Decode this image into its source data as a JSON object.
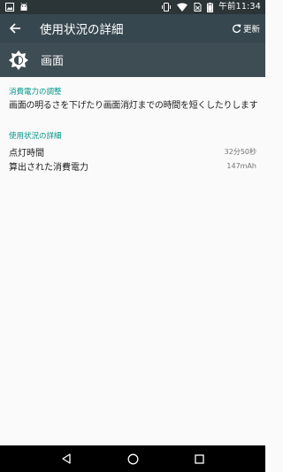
{
  "status_bar": {
    "time": "午前11:34",
    "left_icons": [
      "image-icon",
      "android-icon"
    ],
    "right_icons": [
      "vibrate-icon",
      "wifi-icon",
      "no-sim-icon",
      "battery-icon"
    ]
  },
  "app_bar": {
    "title": "使用状況の詳細",
    "refresh_label": "更新"
  },
  "header": {
    "title": "画面",
    "icon": "brightness-icon"
  },
  "suggestion": {
    "heading": "消費電力の調整",
    "text": "画面の明るさを下げたり画面消灯までの時間を短くしたりします"
  },
  "usage": {
    "heading": "使用状況の詳細",
    "rows": [
      {
        "label": "点灯時間",
        "value": "32分50秒"
      },
      {
        "label": "算出された消費電力",
        "value": "147mAh"
      }
    ]
  },
  "nav_bar": {
    "buttons": [
      "back-icon",
      "home-icon",
      "recents-icon"
    ]
  },
  "colors": {
    "accent": "#009688",
    "app_bar": "#37474f",
    "header": "#3e4c54",
    "status_bar": "#2b3437"
  }
}
